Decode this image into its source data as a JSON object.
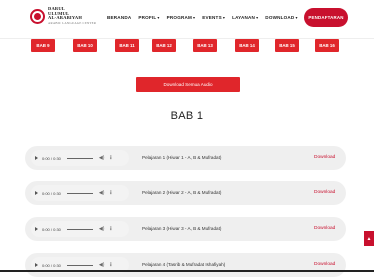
{
  "header": {
    "logo_lines": [
      "DARUL",
      "ULUMUL",
      "AL-ARABIYAH",
      "ARABIC LANGUAGE CENTER"
    ],
    "nav": [
      {
        "label": "BERANDA",
        "caret": false
      },
      {
        "label": "PROFIL",
        "caret": true
      },
      {
        "label": "PROGRAM",
        "caret": true
      },
      {
        "label": "EVENTS",
        "caret": true
      },
      {
        "label": "LAYANAN",
        "caret": true
      },
      {
        "label": "DOWNLOAD",
        "caret": true
      },
      {
        "label": "ARTIKEL",
        "caret": true
      }
    ],
    "register_label": "PENDAFTARAN"
  },
  "chapters": [
    "BAB 9",
    "BAB 10",
    "BAB 11",
    "BAB 12",
    "BAB 13",
    "BAB 14",
    "BAB 15",
    "BAB 16"
  ],
  "download_all_label": "Download Semua Audio",
  "section_title": "BAB 1",
  "tracks": [
    {
      "time": "0:00 / 0:30",
      "title": "Pelajaran 1 (Hiwar 1 - A, B & Mufradat)",
      "download": "Download"
    },
    {
      "time": "0:00 / 0:30",
      "title": "Pelajaran 2 (Hiwar 2 - A, B & Mufradat)",
      "download": "Download"
    },
    {
      "time": "0:00 / 0:30",
      "title": "Pelajaran 3 (Hiwar 3 - A, B & Mufradat)",
      "download": "Download"
    },
    {
      "time": "0:00 / 0:30",
      "title": "Pelajaran 4 (Tasrib & Mufradat Ishafiyah)",
      "download": "Download"
    }
  ],
  "icons": {
    "play": "play-icon",
    "volume": "volume-icon",
    "more": "more-options-icon",
    "scroll_top": "chevron-up-icon"
  },
  "colors": {
    "accent": "#c8102e",
    "chapter_button": "#e0262b",
    "track_bg": "#efefef"
  }
}
